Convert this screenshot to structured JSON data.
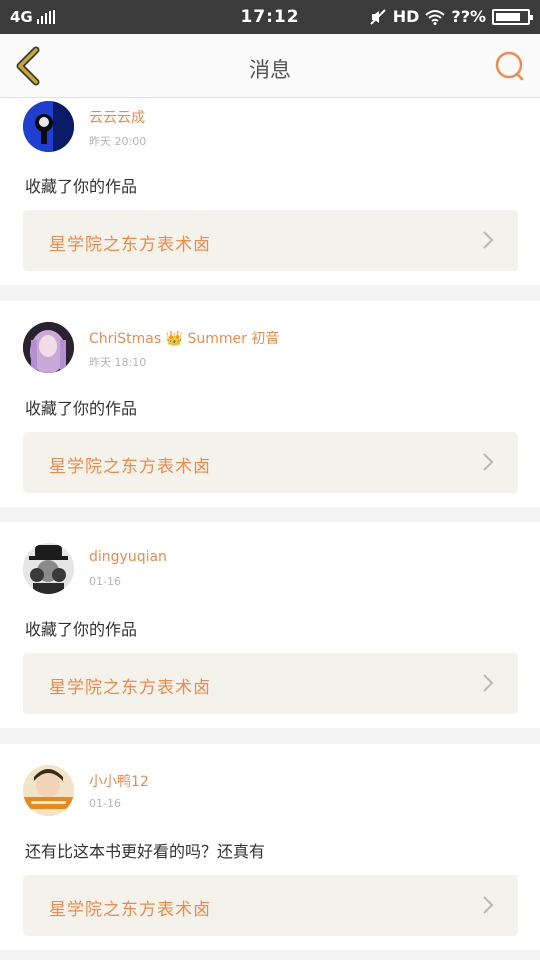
{
  "status_bar": {
    "network": "4G",
    "time": "17:12",
    "hd": "HD",
    "battery": "??%"
  },
  "header": {
    "title": "消息"
  },
  "icons": {
    "back": "chevron-left-icon",
    "search": "search-icon",
    "chevron": "chevron-right-icon"
  },
  "colors": {
    "accent": "#ee8a4d",
    "back_arrow": "#c9a533",
    "link_bg": "#f3f3ec",
    "status_bar_bg": "#3b3b3b"
  },
  "notifications": [
    {
      "user": "云云云成",
      "time": "昨天 20:00",
      "message": "收藏了你的作品",
      "link": "星学院之东方表术卤"
    },
    {
      "user": "ChriStmas 👑 Summer 初音",
      "time": "昨天 18:10",
      "message": "收藏了你的作品",
      "link": "星学院之东方表术卤"
    },
    {
      "user": "dingyuqian",
      "time": "01-16",
      "message": "收藏了你的作品",
      "link": "星学院之东方表术卤"
    },
    {
      "user": "小小鸭12",
      "time": "01-16",
      "message": "还有比这本书更好看的吗？还真有",
      "link": "星学院之东方表术卤"
    }
  ]
}
